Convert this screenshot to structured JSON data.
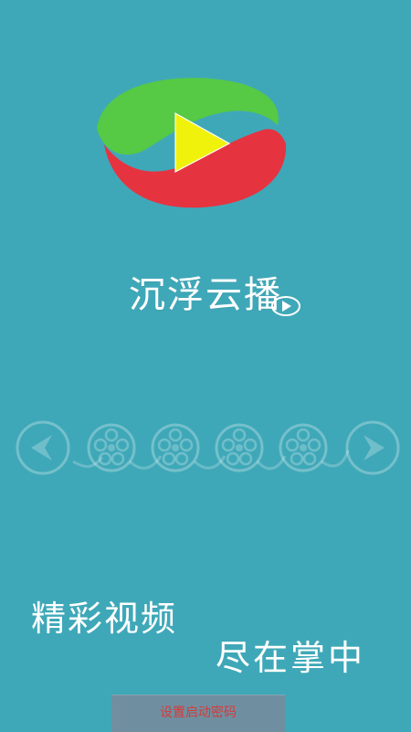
{
  "app": {
    "title": "沉浮云播"
  },
  "slogans": {
    "line1": "精彩视频",
    "line2": "尽在掌中"
  },
  "actions": {
    "set_password_label": "设置启动密码"
  },
  "colors": {
    "background": "#3fa8b8",
    "logo_green": "#56c945",
    "logo_red": "#e63340",
    "logo_yellow": "#f0f20b",
    "button_text": "#d63a3a"
  },
  "icons": {
    "logo": "app-logo-icon",
    "left": "chevron-left-icon",
    "right": "chevron-right-icon",
    "reel": "film-reel-icon"
  }
}
